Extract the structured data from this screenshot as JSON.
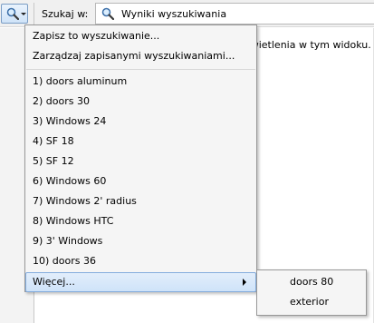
{
  "toolbar": {
    "search_icon": "magnifier-icon",
    "dropdown_icon": "chevron-down-icon",
    "search_in_label": "Szukaj w:",
    "location_icon": "magnifier-icon",
    "location_value": "Wyniki wyszukiwania"
  },
  "content": {
    "empty_message": "świetlenia w tym widoku."
  },
  "menu": {
    "save_search": "Zapisz to wyszukiwanie...",
    "manage_searches": "Zarządzaj zapisanymi wyszukiwaniami...",
    "recent": [
      "1) doors aluminum",
      "2) doors 30",
      "3) Windows 24",
      "4) SF 18",
      "5) SF 12",
      "6) Windows 60",
      "7) Windows 2' radius",
      "8) Windows HTC",
      "9) 3' Windows",
      "10) doors 36"
    ],
    "more": "Więcej...",
    "more_icon": "chevron-right-icon"
  },
  "submenu": {
    "items": [
      "doors 80",
      "exterior"
    ]
  },
  "colors": {
    "highlight_border": "#84acdd",
    "menu_background": "#f5f5f5",
    "toolbar_background": "#f0f0f0"
  }
}
